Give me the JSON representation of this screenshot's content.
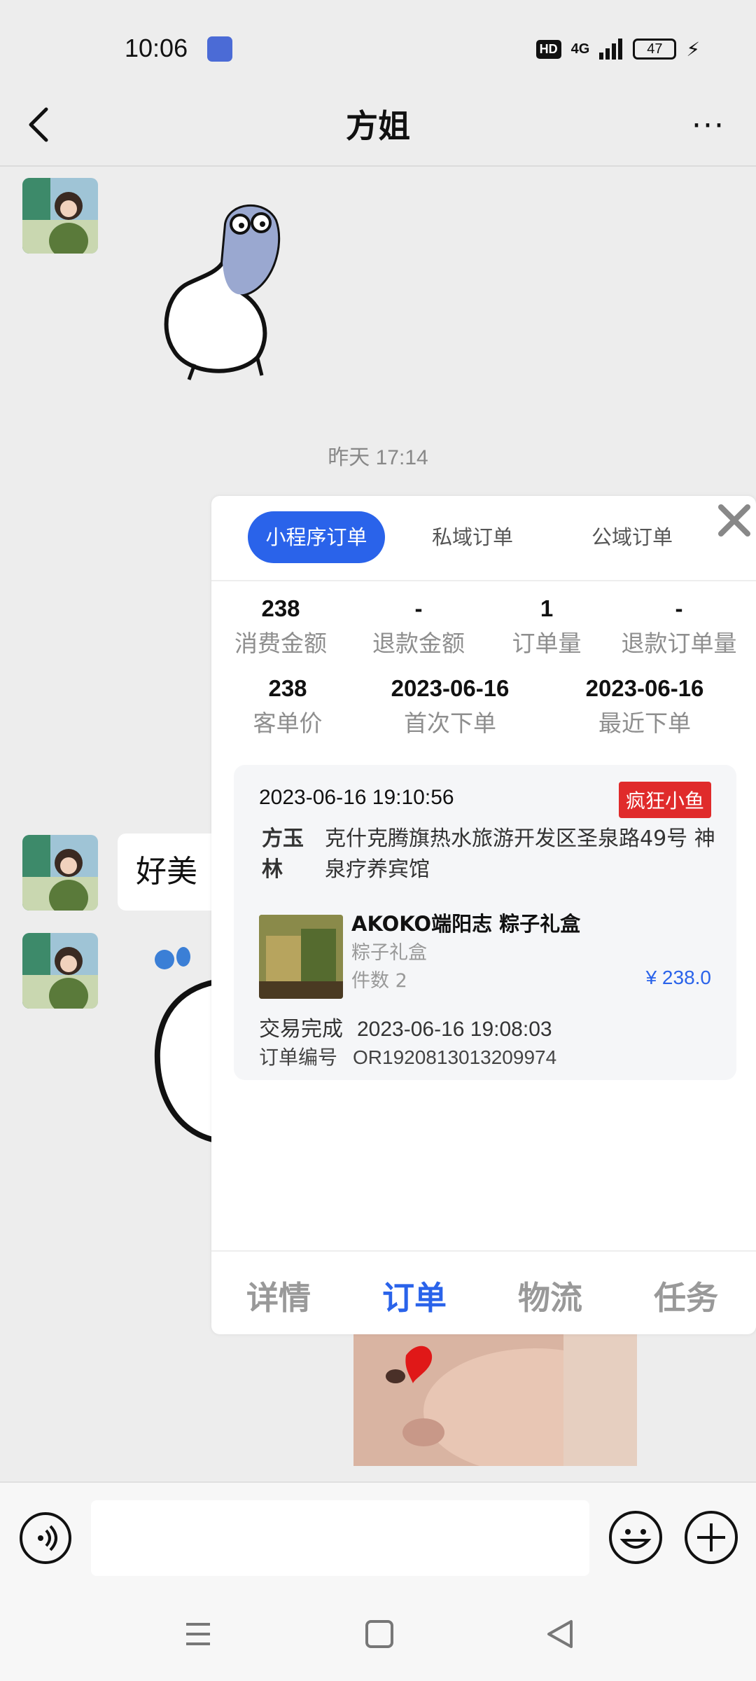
{
  "status_bar": {
    "time": "10:06",
    "hd": "HD",
    "network": "4G",
    "battery": "47"
  },
  "header": {
    "title": "方姐"
  },
  "chat": {
    "timestamp": "昨天 17:14",
    "bubble_text": "好美"
  },
  "popup": {
    "tabs": [
      {
        "label": "小程序订单",
        "active": true
      },
      {
        "label": "私域订单",
        "active": false
      },
      {
        "label": "公域订单",
        "active": false
      }
    ],
    "stats_row1": [
      {
        "value": "238",
        "label": "消费金额"
      },
      {
        "value": "-",
        "label": "退款金额"
      },
      {
        "value": "1",
        "label": "订单量"
      },
      {
        "value": "-",
        "label": "退款订单量"
      }
    ],
    "stats_row2": [
      {
        "value": "238",
        "label": "客单价"
      },
      {
        "value": "2023-06-16",
        "label": "首次下单"
      },
      {
        "value": "2023-06-16",
        "label": "最近下单"
      }
    ],
    "order": {
      "time": "2023-06-16 19:10:56",
      "shop_tag": "疯狂小鱼",
      "customer_name": "方玉林",
      "address": "克什克腾旗热水旅游开发区圣泉路49号 神泉疗养宾馆",
      "product_name": "AKOKO端阳志 粽子礼盒",
      "product_spec": "粽子礼盒",
      "quantity": "件数 2",
      "price": "¥ 238.0",
      "status_label": "交易完成",
      "status_time": "2023-06-16 19:08:03",
      "order_no_label": "订单编号",
      "order_no": "OR1920813013209974"
    },
    "bottom_tabs": [
      {
        "label": "详情",
        "active": false
      },
      {
        "label": "订单",
        "active": true
      },
      {
        "label": "物流",
        "active": false
      },
      {
        "label": "任务",
        "active": false
      }
    ]
  },
  "colors": {
    "accent": "#2a63ea",
    "tag_red": "#e02b2b",
    "background": "#ededed"
  }
}
